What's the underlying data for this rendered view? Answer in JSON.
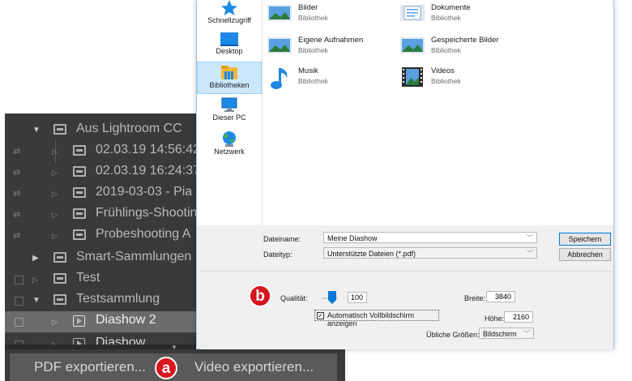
{
  "lightroom": {
    "rows": [
      {
        "label": "Aus Lightroom CC",
        "kind": "set"
      },
      {
        "label": "02.03.19 14:56:42",
        "kind": "collection"
      },
      {
        "label": "02.03.19 16:24:37",
        "kind": "collection"
      },
      {
        "label": "2019-03-03 - Pia",
        "kind": "collection"
      },
      {
        "label": "Frühlings-Shootin",
        "kind": "collection"
      },
      {
        "label": "Probeshooting A",
        "kind": "collection"
      },
      {
        "label": "Smart-Sammlungen",
        "kind": "set"
      },
      {
        "label": "Test",
        "kind": "collection"
      },
      {
        "label": "Testsammlung",
        "kind": "set"
      },
      {
        "label": "Diashow 2",
        "kind": "slideshow",
        "selected": true
      },
      {
        "label": "Diashow",
        "kind": "slideshow"
      }
    ],
    "buttons": {
      "pdf_export": "PDF exportieren...",
      "video_export": "Video exportieren..."
    }
  },
  "dialog": {
    "nav": {
      "quick_access": "Schnellzugriff",
      "desktop": "Desktop",
      "libraries": "Bibliotheken",
      "this_pc": "Dieser PC",
      "network": "Netzwerk"
    },
    "libraries": [
      {
        "name": "Bilder",
        "type": "Bibliothek"
      },
      {
        "name": "Dokumente",
        "type": "Bibliothek"
      },
      {
        "name": "Eigene Aufnahmen",
        "type": "Bibliothek"
      },
      {
        "name": "Gespeicherte Bilder",
        "type": "Bibliothek"
      },
      {
        "name": "Musik",
        "type": "Bibliothek"
      },
      {
        "name": "Videos",
        "type": "Bibliothek"
      }
    ],
    "filename_label": "Dateiname:",
    "filename_value": "Meine Diashow",
    "filetype_label": "Dateityp:",
    "filetype_value": "Unterstützte Dateien (*.pdf)",
    "save_button": "Speichern",
    "cancel_button": "Abbrechen",
    "options": {
      "quality_label": "Qualität:",
      "quality_value": "100",
      "quality_level": 100,
      "fullscreen_label": "Automatisch Vollbildschirm anzeigen",
      "fullscreen_checked": true,
      "width_label": "Breite:",
      "width_value": "3840",
      "height_label": "Höhe:",
      "height_value": "2160",
      "sizes_label": "Übliche Größen:",
      "sizes_value": "Bildschirm"
    }
  },
  "callouts": {
    "a": "a",
    "b": "b"
  },
  "colors": {
    "callout_red": "#d7161e",
    "lr_background": "#3a3a3a",
    "selection_blue": "#cce8ff"
  }
}
